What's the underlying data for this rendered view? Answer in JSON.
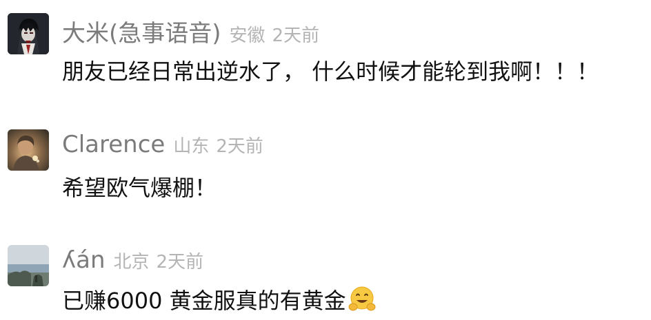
{
  "comments": [
    {
      "name": "大米(急事语音)",
      "location": "安徽",
      "time": "2天前",
      "text": "朋友已经日常出逆水了， 什么时候才能轮到我啊！！！",
      "avatar": "dark-anime-character-avatar"
    },
    {
      "name": "Clarence",
      "location": "山东",
      "time": "2天前",
      "text": "希望欧气爆棚！",
      "avatar": "sunlit-portrait-avatar"
    },
    {
      "name": "ʎán",
      "location": "北京",
      "time": "2天前",
      "text": "已赚6000 黄金服真的有黄金",
      "avatar": "seaside-landscape-avatar",
      "emoji": "hugging-face-emoji"
    }
  ]
}
